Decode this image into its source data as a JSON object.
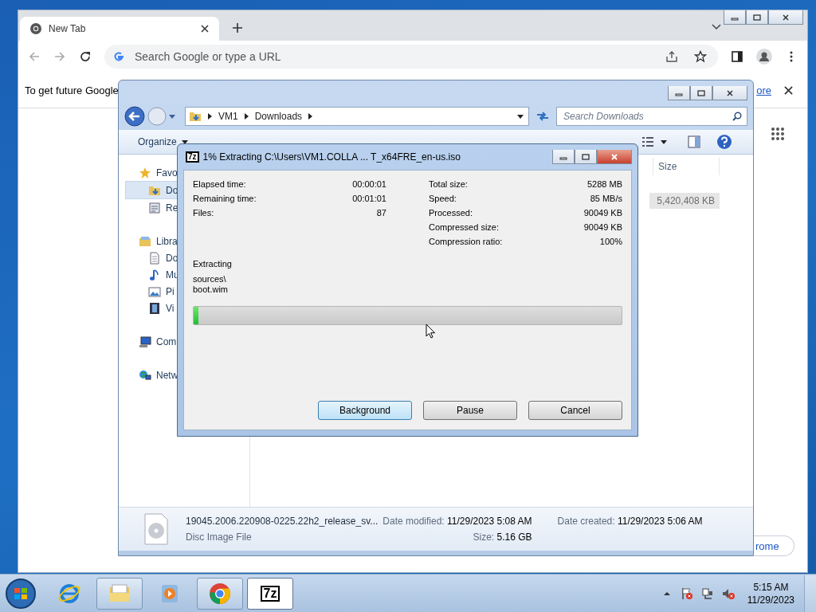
{
  "browser": {
    "tab": {
      "title": "New Tab"
    },
    "address": {
      "placeholder": "Search Google or type a URL"
    },
    "infobar": {
      "text": "To get future Google",
      "link": "ore"
    },
    "shortcut": {
      "label": "rome"
    }
  },
  "explorer": {
    "breadcrumb": [
      "VM1",
      "Downloads"
    ],
    "search": {
      "placeholder": "Search Downloads"
    },
    "toolbar": [
      {
        "label": "Organize",
        "dropdown": true
      }
    ],
    "nav": [
      {
        "label": "Favo",
        "kind": "star",
        "selected": false,
        "children": [
          {
            "label": "Do",
            "kind": "downloads",
            "selected": true
          },
          {
            "label": "Re",
            "kind": "recent",
            "selected": false
          }
        ]
      },
      {
        "label": "Libra",
        "kind": "library",
        "selected": false,
        "children": [
          {
            "label": "Do",
            "kind": "document",
            "selected": false
          },
          {
            "label": "Mu",
            "kind": "music",
            "selected": false
          },
          {
            "label": "Pi",
            "kind": "pictures",
            "selected": false
          },
          {
            "label": "Vi",
            "kind": "video",
            "selected": false
          }
        ]
      },
      {
        "label": "Com",
        "kind": "computer",
        "selected": false
      },
      {
        "label": "Netw",
        "kind": "network",
        "selected": false
      }
    ],
    "columns": [
      "Size"
    ],
    "rows": [
      {
        "size": "5,420,408 KB",
        "selected": true
      }
    ],
    "details": {
      "name": "19045.2006.220908-0225.22h2_release_sv...",
      "type": "Disc Image File",
      "modified": {
        "label": "Date modified:",
        "value": "11/29/2023 5:08 AM"
      },
      "created": {
        "label": "Date created:",
        "value": "11/29/2023 5:06 AM"
      },
      "size": {
        "label": "Size:",
        "value": "5.16 GB"
      }
    }
  },
  "dialog": {
    "logo": "7z",
    "title": "1% Extracting C:\\Users\\VM1.COLLA ... T_x64FRE_en-us.iso",
    "left": [
      {
        "label": "Elapsed time:",
        "value": "00:00:01"
      },
      {
        "label": "Remaining time:",
        "value": "00:01:01"
      },
      {
        "label": "Files:",
        "value": "87"
      }
    ],
    "right": [
      {
        "label": "Total size:",
        "value": "5288 MB"
      },
      {
        "label": "Speed:",
        "value": "85 MB/s"
      },
      {
        "label": "Processed:",
        "value": "90049 KB"
      },
      {
        "label": "Compressed size:",
        "value": "90049 KB"
      },
      {
        "label": "Compression ratio:",
        "value": "100%"
      }
    ],
    "status": "Extracting",
    "path": [
      "sources\\",
      "boot.wim"
    ],
    "progress": {
      "level": 0.012
    },
    "buttons": [
      {
        "label": "Background",
        "default": true
      },
      {
        "label": "Pause",
        "default": false
      },
      {
        "label": "Cancel",
        "default": false
      }
    ]
  },
  "taskbar": {
    "apps": [
      {
        "kind": "ie",
        "running": false,
        "selected": false
      },
      {
        "kind": "explorer",
        "running": true,
        "selected": false
      },
      {
        "kind": "media",
        "running": false,
        "selected": false
      },
      {
        "kind": "chrome",
        "running": true,
        "selected": false
      },
      {
        "kind": "sevenzip",
        "label": "7z",
        "running": true,
        "selected": true
      }
    ],
    "clock": {
      "time": "5:15 AM",
      "date": "11/29/2023"
    }
  }
}
